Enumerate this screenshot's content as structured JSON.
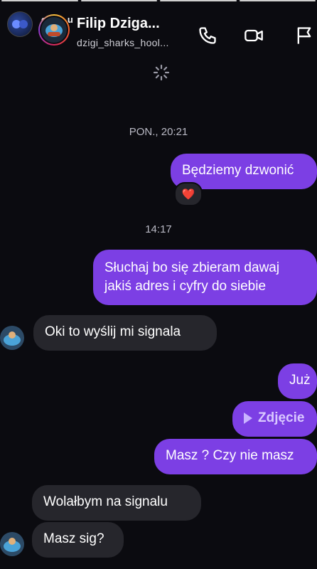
{
  "story": {
    "name": "enzo_u",
    "segments": 4
  },
  "header": {
    "title": "Filip Dziga...",
    "username": "dzigi_sharks_hool...",
    "icons": [
      "phone-icon",
      "video-call-icon",
      "flag-icon"
    ]
  },
  "timestamps": [
    "PON., 20:21",
    "14:17"
  ],
  "messages": [
    {
      "text": "Będziemy dzwonić",
      "direction": "outgoing",
      "reaction": "❤️"
    },
    {
      "text": "Słuchaj bo się zbieram dawaj jakiś adres i cyfry do siebie",
      "line1": "Słuchaj bo się zbieram dawaj",
      "line2": "jakiś adres i cyfry do siebie",
      "direction": "outgoing"
    },
    {
      "text": "Oki to wyślij mi signala",
      "direction": "incoming"
    },
    {
      "text": "Już",
      "direction": "outgoing"
    },
    {
      "text": "Zdjęcie",
      "direction": "outgoing",
      "type": "media"
    },
    {
      "text": "Masz ? Czy nie masz",
      "direction": "outgoing"
    },
    {
      "text": "Wolałbym na signalu",
      "direction": "incoming"
    },
    {
      "text": "Masz sig?",
      "direction": "incoming"
    }
  ],
  "colors": {
    "outgoing_bubble": "#7c3fe4",
    "incoming_bubble": "#26262c",
    "background": "#0b0b10"
  }
}
